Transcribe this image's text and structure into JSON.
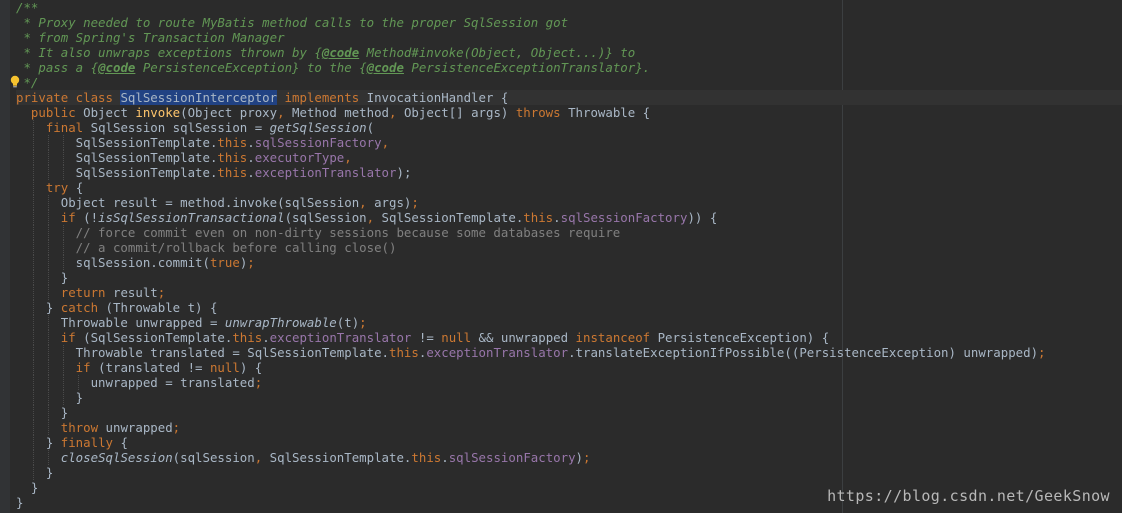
{
  "watermark": "https://blog.csdn.net/GeekSnow",
  "lines": [
    [
      {
        "t": "/**",
        "c": "d"
      }
    ],
    [
      {
        "t": " * Proxy needed to route MyBatis method calls to the proper SqlSession got",
        "c": "d"
      }
    ],
    [
      {
        "t": " * from Spring's Transaction Manager",
        "c": "d"
      }
    ],
    [
      {
        "t": " * It also unwraps exceptions thrown by {",
        "c": "d"
      },
      {
        "t": "@code",
        "c": "dt"
      },
      {
        "t": " Method#invoke(Object, Object...)} to",
        "c": "d"
      }
    ],
    [
      {
        "t": " * pass a {",
        "c": "d"
      },
      {
        "t": "@code",
        "c": "dt"
      },
      {
        "t": " PersistenceException} to the {",
        "c": "d"
      },
      {
        "t": "@code",
        "c": "dt"
      },
      {
        "t": " PersistenceExceptionTranslator}.",
        "c": "d"
      }
    ],
    [
      {
        "t": " */",
        "c": "d"
      }
    ],
    [
      {
        "t": "private class ",
        "c": "k"
      },
      {
        "t": "SqlSessionInterceptor",
        "c": "hl"
      },
      {
        "t": " implements ",
        "c": "k"
      },
      {
        "t": "InvocationHandler {"
      }
    ],
    [
      {
        "t": "  public ",
        "c": "k"
      },
      {
        "t": "Object "
      },
      {
        "t": "invoke",
        "c": "m"
      },
      {
        "t": "(Object proxy"
      },
      {
        "t": ", ",
        "c": "k"
      },
      {
        "t": "Method method"
      },
      {
        "t": ", ",
        "c": "k"
      },
      {
        "t": "Object[] args) "
      },
      {
        "t": "throws ",
        "c": "k"
      },
      {
        "t": "Throwable {"
      }
    ],
    [
      {
        "t": "    final ",
        "c": "k"
      },
      {
        "t": "SqlSession sqlSession = "
      },
      {
        "t": "getSqlSession",
        "c": "it"
      },
      {
        "t": "("
      }
    ],
    [
      {
        "t": "        SqlSessionTemplate."
      },
      {
        "t": "this",
        "c": "k"
      },
      {
        "t": "."
      },
      {
        "t": "sqlSessionFactory",
        "c": "f"
      },
      {
        "t": ",",
        "c": "k"
      }
    ],
    [
      {
        "t": "        SqlSessionTemplate."
      },
      {
        "t": "this",
        "c": "k"
      },
      {
        "t": "."
      },
      {
        "t": "executorType",
        "c": "f"
      },
      {
        "t": ",",
        "c": "k"
      }
    ],
    [
      {
        "t": "        SqlSessionTemplate."
      },
      {
        "t": "this",
        "c": "k"
      },
      {
        "t": "."
      },
      {
        "t": "exceptionTranslator",
        "c": "f"
      },
      {
        "t": ");"
      }
    ],
    [
      {
        "t": "    try ",
        "c": "k"
      },
      {
        "t": "{"
      }
    ],
    [
      {
        "t": "      Object result = method.invoke(sqlSession"
      },
      {
        "t": ", ",
        "c": "k"
      },
      {
        "t": "args)"
      },
      {
        "t": ";",
        "c": "k"
      }
    ],
    [
      {
        "t": "      if ",
        "c": "k"
      },
      {
        "t": "(!"
      },
      {
        "t": "isSqlSessionTransactional",
        "c": "it"
      },
      {
        "t": "(sqlSession"
      },
      {
        "t": ", ",
        "c": "k"
      },
      {
        "t": "SqlSessionTemplate."
      },
      {
        "t": "this",
        "c": "k"
      },
      {
        "t": "."
      },
      {
        "t": "sqlSessionFactory",
        "c": "f"
      },
      {
        "t": ")) {"
      }
    ],
    [
      {
        "t": "        // force commit even on non-dirty sessions because some databases require",
        "c": "c"
      }
    ],
    [
      {
        "t": "        // a commit/rollback before calling close()",
        "c": "c"
      }
    ],
    [
      {
        "t": "        sqlSession.commit("
      },
      {
        "t": "true",
        "c": "k"
      },
      {
        "t": ")"
      },
      {
        "t": ";",
        "c": "k"
      }
    ],
    [
      {
        "t": "      }"
      }
    ],
    [
      {
        "t": "      return ",
        "c": "k"
      },
      {
        "t": "result"
      },
      {
        "t": ";",
        "c": "k"
      }
    ],
    [
      {
        "t": "    } "
      },
      {
        "t": "catch ",
        "c": "k"
      },
      {
        "t": "(Throwable t) {"
      }
    ],
    [
      {
        "t": "      Throwable unwrapped = "
      },
      {
        "t": "unwrapThrowable",
        "c": "it"
      },
      {
        "t": "(t)"
      },
      {
        "t": ";",
        "c": "k"
      }
    ],
    [
      {
        "t": "      if ",
        "c": "k"
      },
      {
        "t": "(SqlSessionTemplate."
      },
      {
        "t": "this",
        "c": "k"
      },
      {
        "t": "."
      },
      {
        "t": "exceptionTranslator",
        "c": "f"
      },
      {
        "t": " != "
      },
      {
        "t": "null",
        "c": "k"
      },
      {
        "t": " && unwrapped "
      },
      {
        "t": "instanceof ",
        "c": "k"
      },
      {
        "t": "PersistenceException) {"
      }
    ],
    [
      {
        "t": "        Throwable translated = SqlSessionTemplate."
      },
      {
        "t": "this",
        "c": "k"
      },
      {
        "t": "."
      },
      {
        "t": "exceptionTranslator",
        "c": "f"
      },
      {
        "t": ".translateExceptionIfPossible((PersistenceException) unwrapped)"
      },
      {
        "t": ";",
        "c": "k"
      }
    ],
    [
      {
        "t": "        if ",
        "c": "k"
      },
      {
        "t": "(translated != "
      },
      {
        "t": "null",
        "c": "k"
      },
      {
        "t": ") {"
      }
    ],
    [
      {
        "t": "          unwrapped = translated"
      },
      {
        "t": ";",
        "c": "k"
      }
    ],
    [
      {
        "t": "        }"
      }
    ],
    [
      {
        "t": "      }"
      }
    ],
    [
      {
        "t": "      throw ",
        "c": "k"
      },
      {
        "t": "unwrapped"
      },
      {
        "t": ";",
        "c": "k"
      }
    ],
    [
      {
        "t": "    } "
      },
      {
        "t": "finally ",
        "c": "k"
      },
      {
        "t": "{"
      }
    ],
    [
      {
        "t": "      "
      },
      {
        "t": "closeSqlSession",
        "c": "it"
      },
      {
        "t": "(sqlSession"
      },
      {
        "t": ", ",
        "c": "k"
      },
      {
        "t": "SqlSessionTemplate."
      },
      {
        "t": "this",
        "c": "k"
      },
      {
        "t": "."
      },
      {
        "t": "sqlSessionFactory",
        "c": "f"
      },
      {
        "t": ")"
      },
      {
        "t": ";",
        "c": "k"
      }
    ],
    [
      {
        "t": "    }"
      }
    ],
    [
      {
        "t": "  }"
      }
    ],
    [
      {
        "t": "}"
      }
    ]
  ]
}
